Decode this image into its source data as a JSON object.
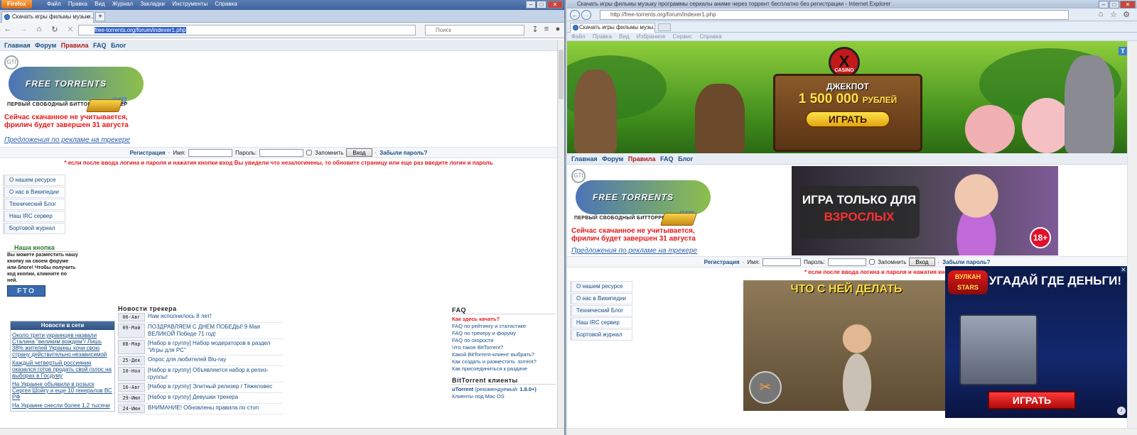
{
  "firefox": {
    "brand": "Firefox",
    "menus": [
      "Файл",
      "Правка",
      "Вид",
      "Журнал",
      "Закладки",
      "Инструменты",
      "Справка"
    ],
    "tab_title": "Скачать игры фильмы музык...",
    "url": "free-torrents.org/forum/indexer1.php",
    "search_placeholder": "Поиск"
  },
  "ie": {
    "window_title": "Скачать игры фильмы музыку программы сериалы аниме через торрент бесплатно без регистрации - Internet Explorer",
    "url": "http://free-torrents.org/forum/indexer1.php",
    "tab_title": "Скачать игры фильмы музы...",
    "menus": [
      "Файл",
      "Правка",
      "Вид",
      "Избранное",
      "Сервис",
      "Справка"
    ]
  },
  "site": {
    "topnav": [
      "Главная",
      "Форум",
      "Правила",
      "FAQ",
      "Блог"
    ],
    "logo_mark": "GTI",
    "logo_word": "FREE TORRENTS",
    "logo_org": ".org",
    "logo_sub": "ПЕРВЫЙ СВОБОДНЫЙ БИТТОРРЕНТ ТРЕКЕР",
    "freeleech": [
      "Сейчас скачанное не учитывается,",
      "фрилич будет завершен 31 августа"
    ],
    "ad_link": "Предложения по рекламе на трекере",
    "login": {
      "register": "Регистрация",
      "name_label": "Имя:",
      "password_label": "Пароль:",
      "remember_label": "Запомнить",
      "submit": "Вход",
      "forgot": "Забыли пароль?"
    },
    "login_warning": "* если после ввода логина и пароля и нажатия кнопки вход Вы увидели что незалогинены, то обновите страницу или еще раз введите логин и пароль",
    "login_warning_ie": "* если после ввода логина и пароля и нажатия кнопки вход Вы увидели что незалогинены, то обновите страниц",
    "sidebar": [
      "О нашем ресурсе",
      "О нас в Википедии",
      "Технический Блог",
      "Наш IRC сервер",
      "Бортовой журнал"
    ],
    "button_box": {
      "title": "Наша кнопка",
      "text": "Вы можете разместить нашу кнопку на своем форуме или блоге! Чтобы получить код кнопки, кликните по ней.",
      "image_text": "FTO"
    },
    "net_news": {
      "title": "Новости в сети",
      "items": [
        "Около трети украинцев назвали Сталина \"великим вождем\"/ Лишь 38% жителей Украины хочи свою страну действительно независимой",
        "Каждый четвертый россиянин оказался готов продать свой голос на выборах в Госдуму",
        "На Украине объявили в розыск Сергея Шойгу и еще 10 генералов ВС РФ",
        "На Украине снесли более 1,2 тысячи"
      ]
    },
    "tracker_news": {
      "title": "Новости трекера",
      "items": [
        {
          "date": "06-Авг",
          "text": "Нам исполнилось 8 лет!"
        },
        {
          "date": "09-Май",
          "text": "ПОЗДРАВЛЯЕМ С ДНЕМ ПОБЕДЫ! 9 Мая ВЕЛИКОЙ Победе 71 год!"
        },
        {
          "date": "08-Мар",
          "text": "[Набор в группу] Набор модераторов в раздел \"Игры для PC\""
        },
        {
          "date": "25-Дек",
          "text": "Опрос для любителей Blu-ray"
        },
        {
          "date": "10-Ноя",
          "text": "[Набор в группу] Объявляется набор в релиз-группы!"
        },
        {
          "date": "16-Авг",
          "text": "[Набор в группу] Элитный релизер / Тяжеловес"
        },
        {
          "date": "29-Июл",
          "text": "[Набор в группу] Девушки трекера"
        },
        {
          "date": "24-Июн",
          "text": "ВНИМАНИЕ! Обновлены правила по стоп"
        }
      ]
    },
    "faq": {
      "title": "FAQ",
      "items": [
        "Как здесь качать?",
        "FAQ по рейтингу и статистике",
        "FAQ по трекеру и форуму",
        "FAQ по скорости",
        "Что такое BitTorrent?",
        "Какой BitTorrent-клиент выбрать?",
        "Как создать и разместить .torrent?",
        "Как присоединиться к раздаче"
      ],
      "clients_title": "BitTorrent клиенты",
      "clients": [
        {
          "name": "uTorrent",
          "note": "(рекомендуемый:",
          "version": "1.8.0+)"
        },
        {
          "name": "Клиенты под Mac OS",
          "note": "",
          "version": ""
        }
      ]
    }
  },
  "ads": {
    "casino": {
      "logo": "CASINO",
      "jackpot": "ДЖЕКПОТ",
      "amount": "1 500 000",
      "currency": "РУБЛЕЙ",
      "button": "ИГРАТЬ"
    },
    "adult": {
      "line1": "ИГРА ТОЛЬКО ДЛЯ",
      "line2": "ВЗРОСЛЫХ",
      "age": "18+"
    },
    "girl": {
      "caption": "ЧТО С НЕЙ ДЕЛАТЬ"
    },
    "vulkan": {
      "brand": "ВУЛКАН STARS",
      "headline": "УГАДАЙ ГДЕ ДЕНЬГИ!",
      "button": "ИГРАТЬ"
    },
    "corner_label": "T"
  }
}
